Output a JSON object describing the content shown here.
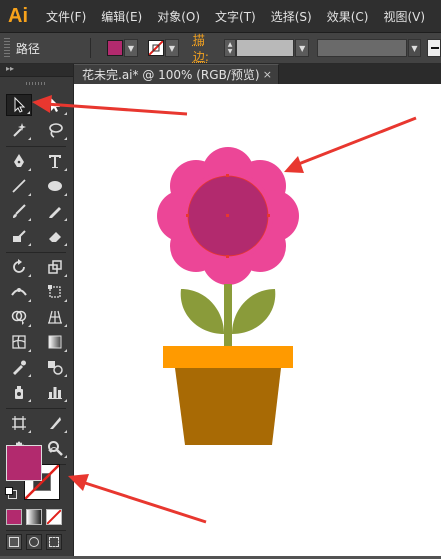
{
  "app": {
    "logo": "Ai",
    "menu": [
      "文件(F)",
      "编辑(E)",
      "对象(O)",
      "文字(T)",
      "选择(S)",
      "效果(C)",
      "视图(V)"
    ]
  },
  "control_bar": {
    "selection_label": "路径",
    "fill_color": "#b22a6e",
    "stroke_label": "描边:"
  },
  "document": {
    "tab_title": "花未完.ai* @ 100% (RGB/预览)",
    "close_glyph": "×"
  },
  "toolbar": {
    "fill_color": "#b22a6e",
    "stroke_color": "none",
    "icons": [
      "selection-tool-icon",
      "direct-selection-tool-icon",
      "magic-wand-icon",
      "lasso-icon",
      "pen-tool-icon",
      "type-tool-icon",
      "line-tool-icon",
      "ellipse-tool-icon",
      "paintbrush-icon",
      "pencil-icon",
      "blob-brush-icon",
      "eraser-icon",
      "rotate-icon",
      "scale-icon",
      "width-tool-icon",
      "free-transform-icon",
      "shape-builder-icon",
      "perspective-grid-icon",
      "mesh-icon",
      "gradient-icon",
      "eyedropper-icon",
      "blend-icon",
      "symbol-sprayer-icon",
      "column-graph-icon",
      "artboard-tool-icon",
      "slice-icon",
      "hand-icon",
      "zoom-icon"
    ]
  },
  "artwork": {
    "petal_color": "#ec4697",
    "center_color": "#b22a6e",
    "stem_color": "#8a9b3a",
    "pot_rim_color": "#ff9a00",
    "pot_body_color": "#a86a05",
    "annotation_color": "#e8372f"
  }
}
